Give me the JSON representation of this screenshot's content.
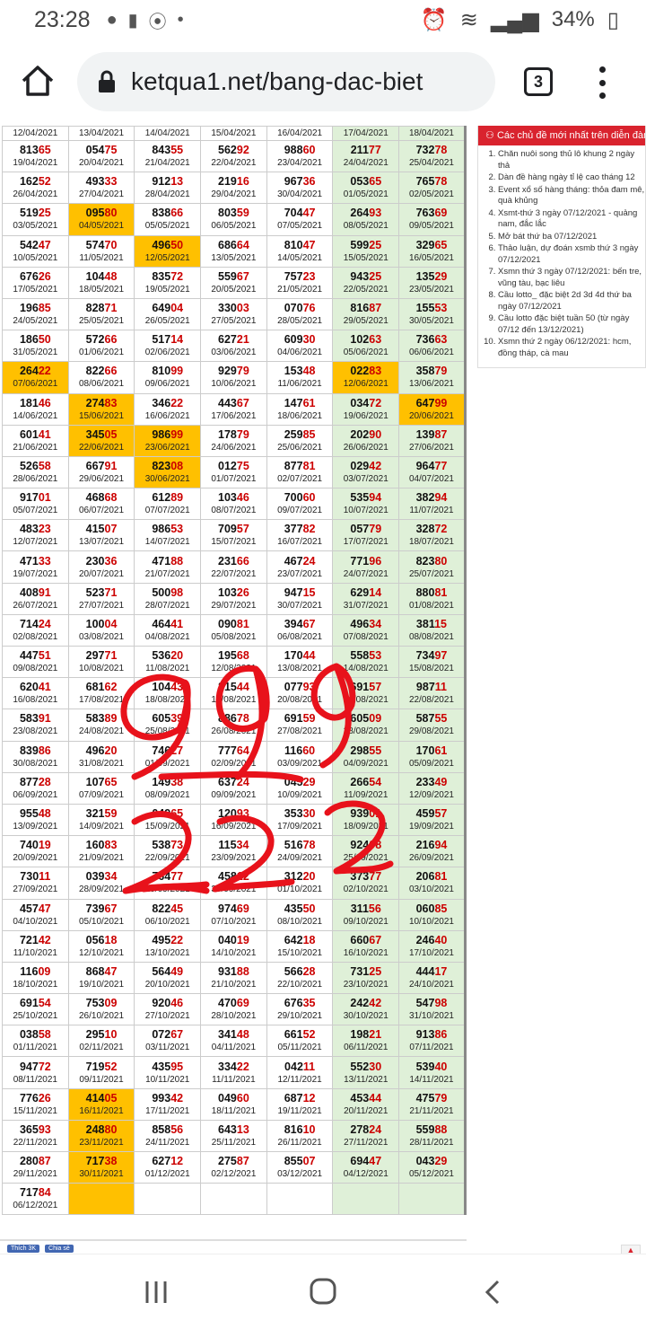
{
  "status_bar": {
    "time": "23:28",
    "battery": "34%"
  },
  "browser": {
    "url": "ketqua1.net/bang-dac-biet",
    "tab_count": "3"
  },
  "sidebar": {
    "header": "Các chủ đề mới nhất trên diễn đàn",
    "items": [
      "Chăn nuôi song thủ lô khung 2 ngày thả",
      "Dàn đề hàng ngày tỉ lệ cao tháng 12",
      "Event xổ số hàng tháng: thỏa đam mê, quà khủng",
      "Xsmt-thứ 3 ngày 07/12/2021 - quảng nam, đắc lắc",
      "Mở bát thứ ba 07/12/2021",
      "Thảo luận, dự đoán xsmb thứ 3 ngày 07/12/2021",
      "Xsmn thứ 3 ngày 07/12/2021: bến tre, vũng tàu, bạc liêu",
      "Cầu lotto_ đặc biệt 2d 3d 4d thứ ba ngày 07/12/2021",
      "Cầu lotto đặc biệt tuần 50 (từ ngày 07/12 đến 13/12/2021)",
      "Xsmn thứ 2 ngày 06/12/2021: hcm, đồng tháp, cà mau"
    ]
  },
  "footer": {
    "like": "Thích 3K",
    "share": "Chia sẻ"
  },
  "table": {
    "top_dates": [
      "12/04/2021",
      "13/04/2021",
      "14/04/2021",
      "15/04/2021",
      "16/04/2021",
      "17/04/2021",
      "18/04/2021"
    ],
    "rows": [
      [
        [
          "81365",
          "19/04/2021"
        ],
        [
          "05475",
          "20/04/2021"
        ],
        [
          "84355",
          "21/04/2021"
        ],
        [
          "56292",
          "22/04/2021"
        ],
        [
          "98860",
          "23/04/2021"
        ],
        [
          "21177",
          "24/04/2021"
        ],
        [
          "73278",
          "25/04/2021"
        ]
      ],
      [
        [
          "16252",
          "26/04/2021"
        ],
        [
          "49333",
          "27/04/2021"
        ],
        [
          "91213",
          "28/04/2021"
        ],
        [
          "21916",
          "29/04/2021"
        ],
        [
          "96736",
          "30/04/2021"
        ],
        [
          "05365",
          "01/05/2021"
        ],
        [
          "76578",
          "02/05/2021"
        ]
      ],
      [
        [
          "51925",
          "03/05/2021"
        ],
        [
          "09580",
          "04/05/2021",
          "h"
        ],
        [
          "83866",
          "05/05/2021"
        ],
        [
          "80359",
          "06/05/2021"
        ],
        [
          "70447",
          "07/05/2021"
        ],
        [
          "26493",
          "08/05/2021"
        ],
        [
          "76369",
          "09/05/2021"
        ]
      ],
      [
        [
          "54247",
          "10/05/2021"
        ],
        [
          "57470",
          "11/05/2021"
        ],
        [
          "49650",
          "12/05/2021",
          "h"
        ],
        [
          "68664",
          "13/05/2021"
        ],
        [
          "81047",
          "14/05/2021"
        ],
        [
          "59925",
          "15/05/2021"
        ],
        [
          "32965",
          "16/05/2021"
        ]
      ],
      [
        [
          "67626",
          "17/05/2021"
        ],
        [
          "10448",
          "18/05/2021"
        ],
        [
          "83572",
          "19/05/2021"
        ],
        [
          "55967",
          "20/05/2021"
        ],
        [
          "75723",
          "21/05/2021"
        ],
        [
          "94325",
          "22/05/2021"
        ],
        [
          "13529",
          "23/05/2021"
        ]
      ],
      [
        [
          "19685",
          "24/05/2021"
        ],
        [
          "82871",
          "25/05/2021"
        ],
        [
          "64904",
          "26/05/2021"
        ],
        [
          "33003",
          "27/05/2021"
        ],
        [
          "07076",
          "28/05/2021"
        ],
        [
          "81687",
          "29/05/2021"
        ],
        [
          "15553",
          "30/05/2021"
        ]
      ],
      [
        [
          "18650",
          "31/05/2021"
        ],
        [
          "57266",
          "01/06/2021"
        ],
        [
          "51714",
          "02/06/2021"
        ],
        [
          "62721",
          "03/06/2021"
        ],
        [
          "60930",
          "04/06/2021"
        ],
        [
          "10263",
          "05/06/2021"
        ],
        [
          "73663",
          "06/06/2021"
        ]
      ],
      [
        [
          "26422",
          "07/06/2021",
          "h"
        ],
        [
          "82266",
          "08/06/2021"
        ],
        [
          "81099",
          "09/06/2021"
        ],
        [
          "92979",
          "10/06/2021"
        ],
        [
          "15348",
          "11/06/2021"
        ],
        [
          "02283",
          "12/06/2021",
          "h"
        ],
        [
          "35879",
          "13/06/2021"
        ]
      ],
      [
        [
          "18146",
          "14/06/2021"
        ],
        [
          "27483",
          "15/06/2021",
          "h"
        ],
        [
          "34622",
          "16/06/2021"
        ],
        [
          "44367",
          "17/06/2021"
        ],
        [
          "14761",
          "18/06/2021"
        ],
        [
          "03472",
          "19/06/2021"
        ],
        [
          "64799",
          "20/06/2021",
          "h"
        ]
      ],
      [
        [
          "60141",
          "21/06/2021"
        ],
        [
          "34505",
          "22/06/2021",
          "h"
        ],
        [
          "98699",
          "23/06/2021",
          "h"
        ],
        [
          "17879",
          "24/06/2021"
        ],
        [
          "25985",
          "25/06/2021"
        ],
        [
          "20290",
          "26/06/2021"
        ],
        [
          "13987",
          "27/06/2021"
        ]
      ],
      [
        [
          "52658",
          "28/06/2021"
        ],
        [
          "66791",
          "29/06/2021"
        ],
        [
          "82308",
          "30/06/2021",
          "h"
        ],
        [
          "01275",
          "01/07/2021"
        ],
        [
          "87781",
          "02/07/2021"
        ],
        [
          "02942",
          "03/07/2021"
        ],
        [
          "96477",
          "04/07/2021"
        ]
      ],
      [
        [
          "91701",
          "05/07/2021"
        ],
        [
          "46868",
          "06/07/2021"
        ],
        [
          "61289",
          "07/07/2021"
        ],
        [
          "10346",
          "08/07/2021"
        ],
        [
          "70060",
          "09/07/2021"
        ],
        [
          "53594",
          "10/07/2021"
        ],
        [
          "38294",
          "11/07/2021"
        ]
      ],
      [
        [
          "48323",
          "12/07/2021"
        ],
        [
          "41507",
          "13/07/2021"
        ],
        [
          "98653",
          "14/07/2021"
        ],
        [
          "70957",
          "15/07/2021"
        ],
        [
          "37782",
          "16/07/2021"
        ],
        [
          "05779",
          "17/07/2021"
        ],
        [
          "32872",
          "18/07/2021"
        ]
      ],
      [
        [
          "47133",
          "19/07/2021"
        ],
        [
          "23036",
          "20/07/2021"
        ],
        [
          "47188",
          "21/07/2021"
        ],
        [
          "23166",
          "22/07/2021"
        ],
        [
          "46724",
          "23/07/2021"
        ],
        [
          "77196",
          "24/07/2021"
        ],
        [
          "82380",
          "25/07/2021"
        ]
      ],
      [
        [
          "40891",
          "26/07/2021"
        ],
        [
          "52371",
          "27/07/2021"
        ],
        [
          "50098",
          "28/07/2021"
        ],
        [
          "10326",
          "29/07/2021"
        ],
        [
          "94715",
          "30/07/2021"
        ],
        [
          "62914",
          "31/07/2021"
        ],
        [
          "88081",
          "01/08/2021"
        ]
      ],
      [
        [
          "71424",
          "02/08/2021"
        ],
        [
          "10004",
          "03/08/2021"
        ],
        [
          "46441",
          "04/08/2021"
        ],
        [
          "09081",
          "05/08/2021"
        ],
        [
          "39467",
          "06/08/2021"
        ],
        [
          "49634",
          "07/08/2021"
        ],
        [
          "38115",
          "08/08/2021"
        ]
      ],
      [
        [
          "44751",
          "09/08/2021"
        ],
        [
          "29771",
          "10/08/2021"
        ],
        [
          "53620",
          "11/08/2021"
        ],
        [
          "19568",
          "12/08/2021"
        ],
        [
          "17044",
          "13/08/2021"
        ],
        [
          "55853",
          "14/08/2021"
        ],
        [
          "73497",
          "15/08/2021"
        ]
      ],
      [
        [
          "62041",
          "16/08/2021"
        ],
        [
          "68162",
          "17/08/2021"
        ],
        [
          "10443",
          "18/08/2021"
        ],
        [
          "21544",
          "19/08/2021"
        ],
        [
          "07793",
          "20/08/2021"
        ],
        [
          "69157",
          "21/08/2021"
        ],
        [
          "98711",
          "22/08/2021"
        ]
      ],
      [
        [
          "58391",
          "23/08/2021"
        ],
        [
          "58389",
          "24/08/2021"
        ],
        [
          "60539",
          "25/08/2021"
        ],
        [
          "88678",
          "26/08/2021"
        ],
        [
          "69159",
          "27/08/2021"
        ],
        [
          "60509",
          "28/08/2021"
        ],
        [
          "58755",
          "29/08/2021"
        ]
      ],
      [
        [
          "83986",
          "30/08/2021"
        ],
        [
          "49620",
          "31/08/2021"
        ],
        [
          "74627",
          "01/09/2021"
        ],
        [
          "77764",
          "02/09/2021"
        ],
        [
          "11660",
          "03/09/2021"
        ],
        [
          "29855",
          "04/09/2021"
        ],
        [
          "17061",
          "05/09/2021"
        ]
      ],
      [
        [
          "87728",
          "06/09/2021"
        ],
        [
          "10765",
          "07/09/2021"
        ],
        [
          "14938",
          "08/09/2021"
        ],
        [
          "63724",
          "09/09/2021"
        ],
        [
          "04529",
          "10/09/2021"
        ],
        [
          "26654",
          "11/09/2021"
        ],
        [
          "23349",
          "12/09/2021"
        ]
      ],
      [
        [
          "95548",
          "13/09/2021"
        ],
        [
          "32159",
          "14/09/2021"
        ],
        [
          "04965",
          "15/09/2021"
        ],
        [
          "12093",
          "16/09/2021"
        ],
        [
          "35330",
          "17/09/2021"
        ],
        [
          "93901",
          "18/09/2021"
        ],
        [
          "45957",
          "19/09/2021"
        ]
      ],
      [
        [
          "74019",
          "20/09/2021"
        ],
        [
          "16083",
          "21/09/2021"
        ],
        [
          "53873",
          "22/09/2021"
        ],
        [
          "11534",
          "23/09/2021"
        ],
        [
          "51678",
          "24/09/2021"
        ],
        [
          "92408",
          "25/09/2021"
        ],
        [
          "21694",
          "26/09/2021"
        ]
      ],
      [
        [
          "73011",
          "27/09/2021"
        ],
        [
          "03934",
          "28/09/2021"
        ],
        [
          "76477",
          "29/09/2021"
        ],
        [
          "45812",
          "30/09/2021"
        ],
        [
          "31220",
          "01/10/2021"
        ],
        [
          "37377",
          "02/10/2021"
        ],
        [
          "20681",
          "03/10/2021"
        ]
      ],
      [
        [
          "45747",
          "04/10/2021"
        ],
        [
          "73967",
          "05/10/2021"
        ],
        [
          "82245",
          "06/10/2021"
        ],
        [
          "97469",
          "07/10/2021"
        ],
        [
          "43550",
          "08/10/2021"
        ],
        [
          "31156",
          "09/10/2021"
        ],
        [
          "06085",
          "10/10/2021"
        ]
      ],
      [
        [
          "72142",
          "11/10/2021"
        ],
        [
          "05618",
          "12/10/2021"
        ],
        [
          "49522",
          "13/10/2021"
        ],
        [
          "04019",
          "14/10/2021"
        ],
        [
          "64218",
          "15/10/2021"
        ],
        [
          "66067",
          "16/10/2021"
        ],
        [
          "24640",
          "17/10/2021"
        ]
      ],
      [
        [
          "11609",
          "18/10/2021"
        ],
        [
          "86847",
          "19/10/2021"
        ],
        [
          "56449",
          "20/10/2021"
        ],
        [
          "93188",
          "21/10/2021"
        ],
        [
          "56628",
          "22/10/2021"
        ],
        [
          "73125",
          "23/10/2021"
        ],
        [
          "44417",
          "24/10/2021"
        ]
      ],
      [
        [
          "69154",
          "25/10/2021"
        ],
        [
          "75309",
          "26/10/2021"
        ],
        [
          "92046",
          "27/10/2021"
        ],
        [
          "47069",
          "28/10/2021"
        ],
        [
          "67635",
          "29/10/2021"
        ],
        [
          "24242",
          "30/10/2021"
        ],
        [
          "54798",
          "31/10/2021"
        ]
      ],
      [
        [
          "03858",
          "01/11/2021"
        ],
        [
          "29510",
          "02/11/2021"
        ],
        [
          "07267",
          "03/11/2021"
        ],
        [
          "34148",
          "04/11/2021"
        ],
        [
          "66152",
          "05/11/2021"
        ],
        [
          "19821",
          "06/11/2021"
        ],
        [
          "91386",
          "07/11/2021"
        ]
      ],
      [
        [
          "94772",
          "08/11/2021"
        ],
        [
          "71952",
          "09/11/2021"
        ],
        [
          "43595",
          "10/11/2021"
        ],
        [
          "33422",
          "11/11/2021"
        ],
        [
          "04211",
          "12/11/2021"
        ],
        [
          "55230",
          "13/11/2021"
        ],
        [
          "53940",
          "14/11/2021"
        ]
      ],
      [
        [
          "77626",
          "15/11/2021"
        ],
        [
          "41405",
          "16/11/2021",
          "h"
        ],
        [
          "99342",
          "17/11/2021"
        ],
        [
          "04960",
          "18/11/2021"
        ],
        [
          "68712",
          "19/11/2021"
        ],
        [
          "45344",
          "20/11/2021"
        ],
        [
          "47579",
          "21/11/2021"
        ]
      ],
      [
        [
          "36593",
          "22/11/2021"
        ],
        [
          "24880",
          "23/11/2021",
          "h"
        ],
        [
          "85856",
          "24/11/2021"
        ],
        [
          "64313",
          "25/11/2021"
        ],
        [
          "81610",
          "26/11/2021"
        ],
        [
          "27824",
          "27/11/2021"
        ],
        [
          "55988",
          "28/11/2021"
        ]
      ],
      [
        [
          "28087",
          "29/11/2021"
        ],
        [
          "71738",
          "30/11/2021",
          "h"
        ],
        [
          "62712",
          "01/12/2021"
        ],
        [
          "27587",
          "02/12/2021"
        ],
        [
          "85507",
          "03/12/2021"
        ],
        [
          "69447",
          "04/12/2021"
        ],
        [
          "04329",
          "05/12/2021"
        ]
      ],
      [
        [
          "71784",
          "06/12/2021"
        ],
        [
          "",
          "",
          "h"
        ],
        [
          "",
          ""
        ],
        [
          "",
          ""
        ],
        [
          "",
          ""
        ],
        [
          "",
          ""
        ],
        [
          "",
          ""
        ]
      ]
    ]
  },
  "colors": {
    "weekend": "#dff0d8",
    "highlight": "#ffc000",
    "tail": "#cc0000",
    "annotation": "#e8121b"
  }
}
